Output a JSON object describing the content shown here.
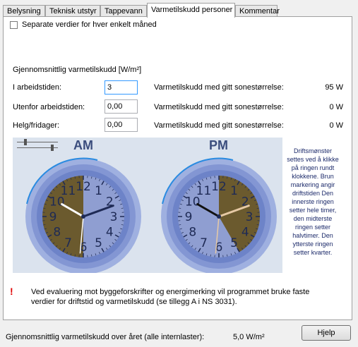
{
  "tabs": [
    {
      "label": "Belysning",
      "active": false
    },
    {
      "label": "Teknisk utstyr",
      "active": false
    },
    {
      "label": "Tappevann",
      "active": false
    },
    {
      "label": "Varmetilskudd personer",
      "active": true
    },
    {
      "label": "Kommentar",
      "active": false
    }
  ],
  "separate_checkbox": {
    "label": "Separate verdier for hver enkelt måned",
    "checked": false
  },
  "section_title": "Gjennomsnittlig varmetilskudd [W/m²]",
  "rows": [
    {
      "label": "I arbeidstiden:",
      "value": "3",
      "result_label": "Varmetilskudd med gitt sonestørrelse:",
      "result_value": "95 W"
    },
    {
      "label": "Utenfor arbeidstiden:",
      "value": "0,00",
      "result_label": "Varmetilskudd med gitt sonestørrelse:",
      "result_value": "0 W"
    },
    {
      "label": "Helg/fridager:",
      "value": "0,00",
      "result_label": "Varmetilskudd med gitt sonestørrelse:",
      "result_value": "0 W"
    }
  ],
  "clocks": {
    "am_label": "AM",
    "pm_label": "PM",
    "numbers": [
      "12",
      "1",
      "2",
      "3",
      "4",
      "5",
      "6",
      "7",
      "8",
      "9",
      "10",
      "11"
    ],
    "help_text": "Driftsmønster settes ved å klikke på ringen rundt klokkene. Brun markering angir driftstiden Den innerste ringen setter hele timer, den midterste ringen setter halvtimer. Den ytterste ringen setter kvarter.",
    "am_operating_hours": [
      6,
      12
    ],
    "pm_operating_hours": [
      12,
      17
    ],
    "colors": {
      "operating": "#6b5a2e",
      "dial": "#8f9ed1",
      "ring": "#6d83c8",
      "outer": "#9fb0e0"
    }
  },
  "warning": {
    "mark": "!",
    "text": "Ved evaluering mot byggeforskrifter og energimerking vil programmet bruke faste verdier for driftstid og varmetilskudd (se tillegg A i NS 3031)."
  },
  "footer": {
    "label": "Gjennomsnittlig varmetilskudd over året (alle internlaster):",
    "value": "5,0 W/m²",
    "help_button": "Hjelp"
  }
}
